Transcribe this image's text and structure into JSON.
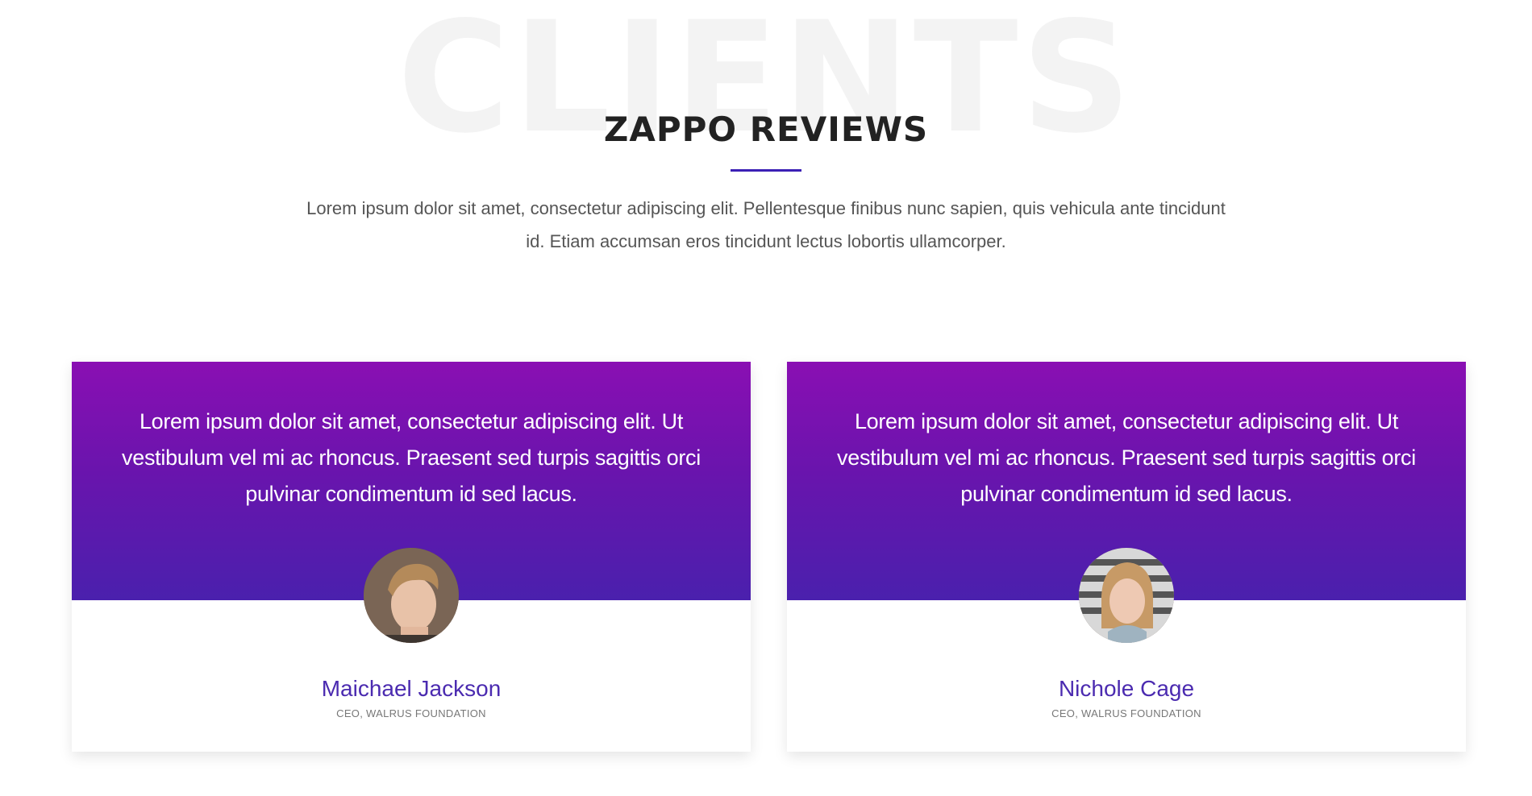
{
  "section": {
    "watermark": "CLIENTS",
    "title": "ZAPPO REVIEWS",
    "intro": "Lorem ipsum dolor sit amet, consectetur adipiscing elit. Pellentesque finibus nunc sapien, quis vehicula ante tincidunt id. Etiam accumsan eros tincidunt lectus lobortis ullamcorper."
  },
  "colors": {
    "accent": "#3b1fb5",
    "gradient_top": "#8a0fb3",
    "gradient_bottom": "#4a20ad",
    "name_color": "#4b2bb0"
  },
  "testimonials": [
    {
      "quote": "Lorem ipsum dolor sit amet, consectetur adipiscing elit. Ut vestibulum vel mi ac rhoncus. Praesent sed turpis sagittis orci pulvinar condimentum id sed lacus.",
      "name": "Maichael Jackson",
      "role": "CEO, WALRUS FOUNDATION",
      "avatar_icon": "man-avatar"
    },
    {
      "quote": "Lorem ipsum dolor sit amet, consectetur adipiscing elit. Ut vestibulum vel mi ac rhoncus. Praesent sed turpis sagittis orci pulvinar condimentum id sed lacus.",
      "name": "Nichole Cage",
      "role": "CEO, WALRUS FOUNDATION",
      "avatar_icon": "woman-avatar"
    }
  ]
}
